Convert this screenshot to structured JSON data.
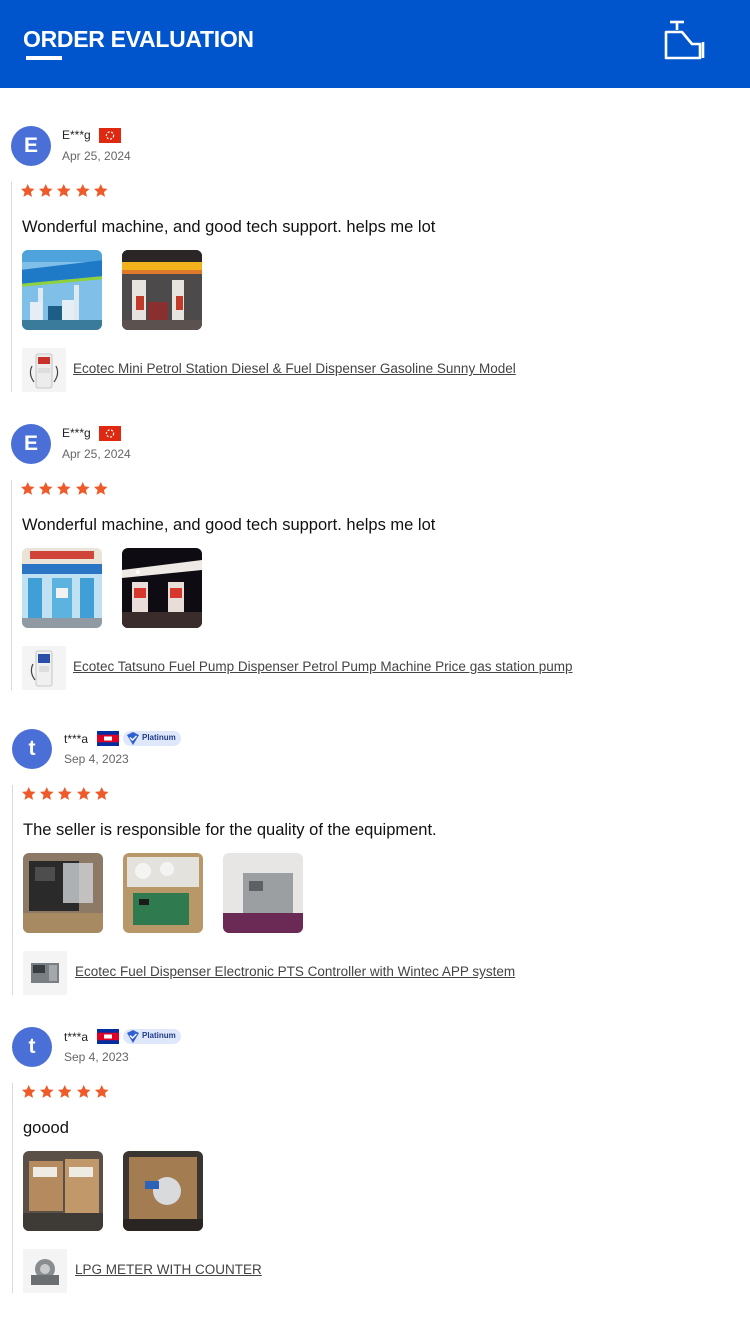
{
  "header": {
    "title": "ORDER EVALUATION",
    "icon": "oil-can-icon",
    "bg_color": "#0055cc"
  },
  "rating_color": "#ee5a2a",
  "reviews": [
    {
      "avatar_letter": "E",
      "user": "E***g",
      "flag": "hong-kong-flag",
      "badge": "",
      "date": "Apr 25, 2024",
      "rating": 5,
      "text": "Wonderful machine, and good tech support. helps me lot",
      "product": "Ecotec Mini Petrol Station Diesel & Fuel Dispenser Gasoline Sunny Model"
    },
    {
      "avatar_letter": "E",
      "user": "E***g",
      "flag": "hong-kong-flag",
      "badge": "",
      "date": "Apr 25, 2024",
      "rating": 5,
      "text": "Wonderful machine, and good tech support. helps me lot",
      "product": "Ecotec Tatsuno Fuel Pump Dispenser Petrol Pump Machine Price gas station pump"
    },
    {
      "avatar_letter": "t",
      "user": "t***a",
      "flag": "cambodia-flag",
      "badge": "Platinum",
      "date": "Sep 4, 2023",
      "rating": 5,
      "text": "The seller is responsible for the quality of the equipment.",
      "product": "Ecotec Fuel Dispenser Electronic PTS Controller with Wintec APP system"
    },
    {
      "avatar_letter": "t",
      "user": "t***a",
      "flag": "cambodia-flag",
      "badge": "Platinum",
      "date": "Sep 4, 2023",
      "rating": 5,
      "text": "goood",
      "product": "LPG METER WITH COUNTER"
    }
  ]
}
